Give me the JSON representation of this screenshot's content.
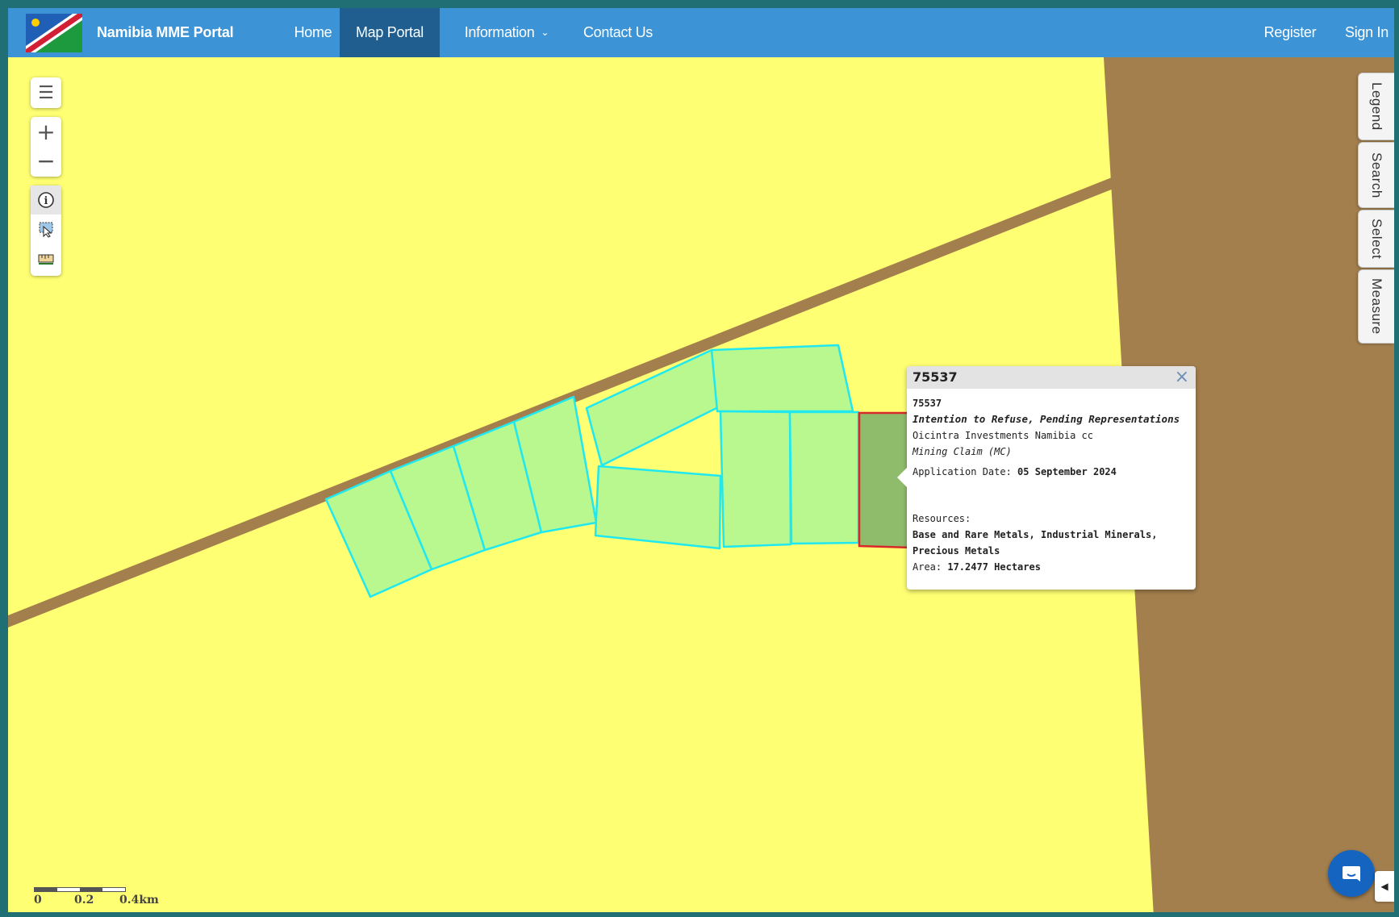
{
  "header": {
    "brand": "Namibia MME Portal",
    "nav": [
      {
        "label": "Home"
      },
      {
        "label": "Map Portal",
        "active": true
      },
      {
        "label": "Information"
      },
      {
        "label": "Contact Us"
      }
    ],
    "register": "Register",
    "sign_in": "Sign In"
  },
  "map_controls": {
    "layers_icon": "menu-icon",
    "zoom_in": "+",
    "zoom_out": "−",
    "tools": [
      "info-icon",
      "select-area-icon",
      "measure-ruler-icon"
    ]
  },
  "side_tabs": [
    "Legend",
    "Search",
    "Select",
    "Measure"
  ],
  "popup": {
    "title": "75537",
    "id": "75537",
    "status": "Intention to Refuse, Pending Representations",
    "holder": "Oicintra Investments Namibia cc",
    "type": "Mining Claim (MC)",
    "application_date_label": "Application Date: ",
    "application_date": "05 September 2024",
    "resources_label": "Resources:",
    "resources_line1": "Base and Rare Metals, Industrial Minerals,",
    "resources_line2": "Precious Metals",
    "area_label": "Area: ",
    "area_value": "17.2477 Hectares",
    "close": "×"
  },
  "scale": {
    "t0": "0",
    "t1": "0.2",
    "t2": "0.4km"
  },
  "colors": {
    "background": "#ffff73",
    "road": "#a47f4e",
    "parcel_fill": "#b9f88f",
    "parcel_outline": "#1fe8f0",
    "selected_fill": "#8fbc6b",
    "selected_outline": "#d8282a",
    "navbar": "#3c94d6",
    "nav_active": "#1f5e8e"
  }
}
